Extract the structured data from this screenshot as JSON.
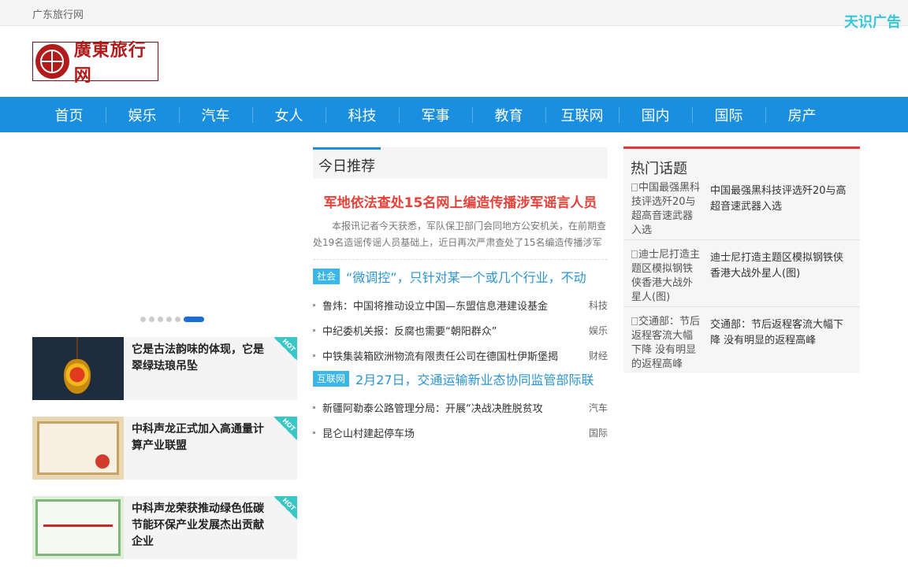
{
  "topbar": {
    "site_name": "广东旅行网",
    "ad_text": "天识广告"
  },
  "header": {
    "logo_text": "廣東旅行网"
  },
  "nav": {
    "items": [
      "首页",
      "娱乐",
      "汽车",
      "女人",
      "科技",
      "军事",
      "教育",
      "互联网",
      "国内",
      "国际",
      "房产"
    ]
  },
  "left": {
    "slider_dots": 6,
    "slider_active_dot": 6,
    "cards": [
      {
        "title": "它是古法韵味的体现，它是翠绿珐琅吊坠",
        "badge": "HOT"
      },
      {
        "title": "中科声龙正式加入高通量计算产业联盟",
        "badge": "HOT"
      },
      {
        "title": "中科声龙荣获推动绿色低碳节能环保产业发展杰出贡献企业",
        "badge": "HOT"
      }
    ]
  },
  "mid": {
    "section_title": "今日推荐",
    "headline": "军地依法查处15名网上编造传播涉军谣言人员",
    "summary": "本报讯记者今天获悉，军队保卫部门会同地方公安机关，在前期查处19名造谣传谣人员基础上，近日再次严肃查处了15名编造传播涉军",
    "group1": {
      "tag": "社会",
      "lead": "“微调控”，只针对某一个或几个行业，不动",
      "items": [
        {
          "title": "鲁炜：中国将推动设立中国—东盟信息港建设基金",
          "cat": "科技"
        },
        {
          "title": "中纪委机关报：反腐也需要“朝阳群众”",
          "cat": "娱乐"
        },
        {
          "title": "中铁集装箱欧洲物流有限责任公司在德国杜伊斯堡揭",
          "cat": "财经"
        }
      ]
    },
    "group2": {
      "tag": "互联网",
      "lead": "2月27日，交通运输新业态协同监管部际联",
      "items": [
        {
          "title": "新疆阿勒泰公路管理分局：开展“决战决胜脱贫攻",
          "cat": "汽车"
        },
        {
          "title": "昆仑山村建起停车场",
          "cat": "国际"
        }
      ]
    }
  },
  "right": {
    "section_title": "热门话题",
    "topics": [
      {
        "img_alt": "中国最强黑科技评选歼20与超高音速武器入选",
        "title": "中国最强黑科技评选歼20与高超音速武器入选"
      },
      {
        "img_alt": "迪士尼打造主题区模拟钢铁侠香港大战外星人(图)",
        "title": "迪士尼打造主题区模拟钢铁侠香港大战外星人(图)"
      },
      {
        "img_alt": "交通部：节后返程客流大幅下降 没有明显的返程高峰",
        "title": "交通部：节后返程客流大幅下降 没有明显的返程高峰"
      }
    ]
  },
  "colors": {
    "nav_blue": "#1a8fe0",
    "headline_red": "#e5423a",
    "tag_blue": "#39b7e8",
    "hot_badge": "#38c6c6",
    "hot_topic_red": "#e4393c"
  }
}
